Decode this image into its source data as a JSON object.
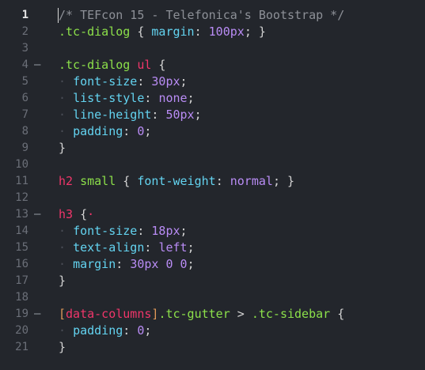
{
  "editor": {
    "active_line": 1,
    "lines": [
      {
        "n": "1",
        "fold": "",
        "tokens": [
          [
            "comment",
            "/* TEFcon 15 - Telefonica's Bootstrap */"
          ]
        ]
      },
      {
        "n": "2",
        "fold": "",
        "tokens": [
          [
            "sel",
            ".tc-dialog"
          ],
          [
            "punct",
            " { "
          ],
          [
            "prop",
            "margin"
          ],
          [
            "punct",
            ": "
          ],
          [
            "num",
            "100px"
          ],
          [
            "punct",
            "; }"
          ]
        ]
      },
      {
        "n": "3",
        "fold": "",
        "tokens": []
      },
      {
        "n": "4",
        "fold": "–",
        "tokens": [
          [
            "sel",
            ".tc-dialog"
          ],
          [
            "punct",
            " "
          ],
          [
            "tag",
            "ul"
          ],
          [
            "punct",
            " {"
          ]
        ]
      },
      {
        "n": "5",
        "fold": "",
        "tokens": [
          [
            "indent",
            "· "
          ],
          [
            "prop",
            "font-size"
          ],
          [
            "punct",
            ": "
          ],
          [
            "num",
            "30px"
          ],
          [
            "punct",
            ";"
          ]
        ]
      },
      {
        "n": "6",
        "fold": "",
        "tokens": [
          [
            "indent",
            "· "
          ],
          [
            "prop",
            "list-style"
          ],
          [
            "punct",
            ": "
          ],
          [
            "kw",
            "none"
          ],
          [
            "punct",
            ";"
          ]
        ]
      },
      {
        "n": "7",
        "fold": "",
        "tokens": [
          [
            "indent",
            "· "
          ],
          [
            "prop",
            "line-height"
          ],
          [
            "punct",
            ": "
          ],
          [
            "num",
            "50px"
          ],
          [
            "punct",
            ";"
          ]
        ]
      },
      {
        "n": "8",
        "fold": "",
        "tokens": [
          [
            "indent",
            "· "
          ],
          [
            "prop",
            "padding"
          ],
          [
            "punct",
            ": "
          ],
          [
            "num",
            "0"
          ],
          [
            "punct",
            ";"
          ]
        ]
      },
      {
        "n": "9",
        "fold": "",
        "tokens": [
          [
            "punct",
            "}"
          ]
        ]
      },
      {
        "n": "10",
        "fold": "",
        "tokens": []
      },
      {
        "n": "11",
        "fold": "",
        "tokens": [
          [
            "tag",
            "h2"
          ],
          [
            "punct",
            " "
          ],
          [
            "sel",
            "small"
          ],
          [
            "punct",
            " { "
          ],
          [
            "prop",
            "font-weight"
          ],
          [
            "punct",
            ": "
          ],
          [
            "kw",
            "normal"
          ],
          [
            "punct",
            "; }"
          ]
        ]
      },
      {
        "n": "12",
        "fold": "",
        "tokens": []
      },
      {
        "n": "13",
        "fold": "–",
        "tokens": [
          [
            "tag",
            "h3"
          ],
          [
            "punct",
            " {"
          ],
          [
            "tag",
            "·"
          ]
        ]
      },
      {
        "n": "14",
        "fold": "",
        "tokens": [
          [
            "indent",
            "· "
          ],
          [
            "prop",
            "font-size"
          ],
          [
            "punct",
            ": "
          ],
          [
            "num",
            "18px"
          ],
          [
            "punct",
            ";"
          ]
        ]
      },
      {
        "n": "15",
        "fold": "",
        "tokens": [
          [
            "indent",
            "· "
          ],
          [
            "prop",
            "text-align"
          ],
          [
            "punct",
            ": "
          ],
          [
            "kw",
            "left"
          ],
          [
            "punct",
            ";"
          ]
        ]
      },
      {
        "n": "16",
        "fold": "",
        "tokens": [
          [
            "indent",
            "· "
          ],
          [
            "prop",
            "margin"
          ],
          [
            "punct",
            ": "
          ],
          [
            "num",
            "30px 0 0"
          ],
          [
            "punct",
            ";"
          ]
        ]
      },
      {
        "n": "17",
        "fold": "",
        "tokens": [
          [
            "punct",
            "}"
          ]
        ]
      },
      {
        "n": "18",
        "fold": "",
        "tokens": []
      },
      {
        "n": "19",
        "fold": "–",
        "tokens": [
          [
            "attrbr",
            "["
          ],
          [
            "tag",
            "data-columns"
          ],
          [
            "attrbr",
            "]"
          ],
          [
            "sel",
            ".tc-gutter"
          ],
          [
            "op",
            " > "
          ],
          [
            "sel",
            ".tc-sidebar"
          ],
          [
            "punct",
            " {"
          ]
        ]
      },
      {
        "n": "20",
        "fold": "",
        "tokens": [
          [
            "indent",
            "· "
          ],
          [
            "prop",
            "padding"
          ],
          [
            "punct",
            ": "
          ],
          [
            "num",
            "0"
          ],
          [
            "punct",
            ";"
          ]
        ]
      },
      {
        "n": "21",
        "fold": "",
        "tokens": [
          [
            "punct",
            "}"
          ]
        ]
      }
    ]
  }
}
